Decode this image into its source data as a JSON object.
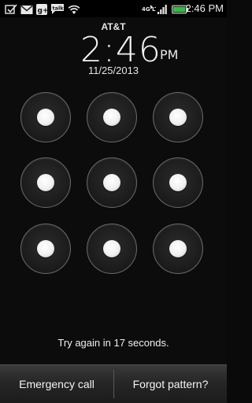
{
  "status_bar": {
    "time": "2:46 PM",
    "left_icons": [
      "task-checkbox-icon",
      "gmail-icon",
      "google-plus-icon",
      "talk-icon",
      "wifi-icon"
    ],
    "talk_label": "talk",
    "network_label": "4G LTE",
    "right_icons": [
      "network-4g-lte-icon",
      "signal-icon",
      "battery-icon"
    ]
  },
  "lockscreen": {
    "carrier": "AT&T",
    "clock": "2:46",
    "ampm": "PM",
    "date": "11/25/2013",
    "pattern_grid": {
      "rows": 3,
      "cols": 3
    },
    "message": "Try again in 17 seconds."
  },
  "bottom_bar": {
    "emergency_label": "Emergency call",
    "forgot_label": "Forgot pattern?"
  },
  "colors": {
    "background": "#0c0c0c",
    "text": "#f2f2f2",
    "battery": "#3cb64a",
    "node_ring": "#6a6a6a",
    "node_dot": "#ffffff"
  }
}
